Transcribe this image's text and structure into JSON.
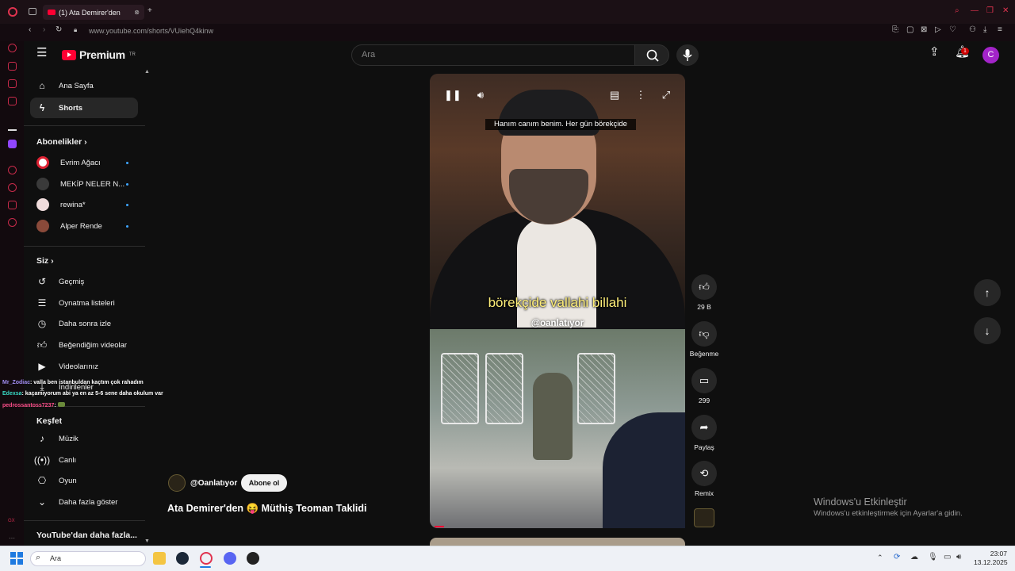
{
  "browser": {
    "tab_title": "(1) Ata Demirer'den",
    "url": "www.youtube.com/shorts/VUiehQ4kinw"
  },
  "header": {
    "logo_text": "Premium",
    "logo_region": "TR",
    "search_placeholder": "Ara",
    "notifications_count": "1",
    "avatar_letter": "C"
  },
  "sidebar": {
    "main_items": [
      {
        "label": "Ana Sayfa"
      },
      {
        "label": "Shorts"
      }
    ],
    "subscriptions_heading": "Abonelikler",
    "subscriptions": [
      {
        "label": "Evrim Ağacı"
      },
      {
        "label": "MEKİP NELER N..."
      },
      {
        "label": "rewina*"
      },
      {
        "label": "Alper Rende"
      }
    ],
    "you_heading": "Siz",
    "you_items": [
      {
        "label": "Geçmiş"
      },
      {
        "label": "Oynatma listeleri"
      },
      {
        "label": "Daha sonra izle"
      },
      {
        "label": "Beğendiğim videolar"
      },
      {
        "label": "Videolarınız"
      },
      {
        "label": "İndirilenler"
      }
    ],
    "explore_heading": "Keşfet",
    "explore_items": [
      {
        "label": "Müzik"
      },
      {
        "label": "Canlı"
      },
      {
        "label": "Oyun"
      },
      {
        "label": "Daha fazla göster"
      }
    ],
    "more_heading": "YouTube'dan daha fazla..."
  },
  "chat": [
    {
      "user": "Mr_Zodiac",
      "text": ": valla ben istanbuldan kaçtım çok rahadım"
    },
    {
      "user": "Edexsa",
      "text": ": kaçamıyorum abi ya en az 5-6 sene daha okulum var"
    },
    {
      "user": "pedrossantoss7237",
      "text": ":"
    }
  ],
  "video": {
    "subtitle_top": "Hanım canım benim. Her gün börekçide",
    "subtitle_main": "börekçide vallahi billahi",
    "watermark": "@oanlatıyor",
    "channel": "@Oanlatıyor",
    "subscribe_label": "Abone ol",
    "title": "Ata Demirer'den 😝 Müthiş Teoman Taklidi",
    "progress_fraction": 0.04
  },
  "actions": {
    "likes": "29 B",
    "dislike_label": "Beğenme",
    "comments": "299",
    "share_label": "Paylaş",
    "remix_label": "Remix"
  },
  "windows": {
    "activate_title": "Windows'u Etkinleştir",
    "activate_sub": "Windows'u etkinleştirmek için Ayarlar'a gidin.",
    "search_placeholder": "Ara",
    "time": "23:07",
    "date": "13.12.2025"
  },
  "colors": {
    "brand_red": "#ff0033",
    "opera_red": "#c72a4a",
    "accent_blue": "#3ea6ff",
    "avatar_purple": "#a324c9"
  }
}
